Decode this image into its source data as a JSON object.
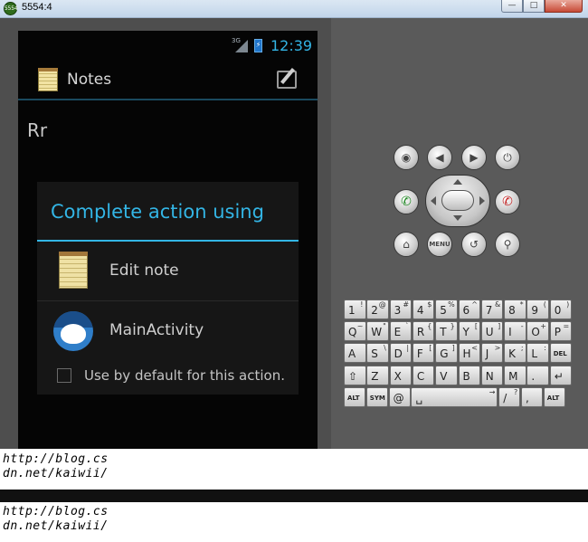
{
  "window": {
    "title": "5554:4",
    "icon_text": "5554",
    "controls": [
      "minimize",
      "maximize",
      "close"
    ]
  },
  "status_bar": {
    "network": "3G",
    "clock": "12:39"
  },
  "app": {
    "title": "Notes",
    "note_text": "Rr"
  },
  "dialog": {
    "title": "Complete action using",
    "options": [
      {
        "label": "Edit note",
        "icon": "notes-icon"
      },
      {
        "label": "MainActivity",
        "icon": "android-icon"
      }
    ],
    "default_label": "Use by default for this action.",
    "default_checked": false
  },
  "hardware_buttons": {
    "row1": [
      "camera-icon",
      "volume-down-icon",
      "volume-up-icon",
      "power-icon"
    ],
    "row2": [
      "call-icon",
      "dpad",
      "end-call-icon"
    ],
    "row3": [
      "home-icon",
      "menu",
      "back-icon",
      "search-icon"
    ],
    "menu_label": "MENU"
  },
  "keyboard": {
    "rows": [
      [
        [
          "1",
          "!"
        ],
        [
          "2",
          "@"
        ],
        [
          "3",
          "#"
        ],
        [
          "4",
          "$"
        ],
        [
          "5",
          "%"
        ],
        [
          "6",
          "^"
        ],
        [
          "7",
          "&"
        ],
        [
          "8",
          "*"
        ],
        [
          "9",
          "("
        ],
        [
          "0",
          ")"
        ]
      ],
      [
        [
          "Q",
          "~"
        ],
        [
          "W",
          "\""
        ],
        [
          "E",
          "`"
        ],
        [
          "R",
          "{"
        ],
        [
          "T",
          "}"
        ],
        [
          "Y",
          "["
        ],
        [
          "U",
          "]"
        ],
        [
          "I",
          "-"
        ],
        [
          "O",
          "+"
        ],
        [
          "P",
          "="
        ]
      ],
      [
        [
          "A",
          ""
        ],
        [
          "S",
          "\\"
        ],
        [
          "D",
          "|"
        ],
        [
          "F",
          "["
        ],
        [
          "G",
          "]"
        ],
        [
          "H",
          "<"
        ],
        [
          "J",
          ">"
        ],
        [
          "K",
          ";"
        ],
        [
          "L",
          ":"
        ],
        [
          "DEL",
          ""
        ]
      ],
      [
        [
          "⇧",
          ""
        ],
        [
          "Z",
          ""
        ],
        [
          "X",
          ""
        ],
        [
          "C",
          ""
        ],
        [
          "V",
          ""
        ],
        [
          "B",
          ""
        ],
        [
          "N",
          ""
        ],
        [
          "M",
          ""
        ],
        [
          ".",
          ""
        ],
        [
          "↵",
          ""
        ]
      ],
      [
        [
          "ALT",
          ""
        ],
        [
          "SYM",
          ""
        ],
        [
          "@",
          ""
        ],
        [
          "␣",
          "→"
        ],
        [
          "/",
          "?"
        ],
        [
          ",",
          ""
        ],
        [
          "ALT",
          ""
        ]
      ]
    ]
  },
  "colors": {
    "accent": "#33b5e5",
    "emulator_bg": "#4e4e4e"
  },
  "watermark": {
    "line1": "http://blog.cs",
    "line2": "dn.net/kaiwii/"
  }
}
